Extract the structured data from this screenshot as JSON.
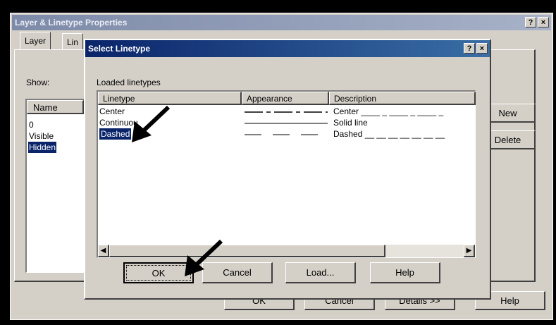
{
  "outer": {
    "title": "Layer & Linetype Properties",
    "help_btn": "?",
    "close_btn": "×",
    "tabs": [
      "Layer",
      "Lin"
    ],
    "show_label": "Show:",
    "list_header": "Name",
    "layers": [
      "0",
      "Visible",
      "Hidden"
    ],
    "new_btn": "New",
    "delete_btn": "Delete",
    "ok_btn": "OK",
    "cancel_btn": "Cancel",
    "details_btn": "Details >>",
    "help_footer_btn": "Help"
  },
  "dialog": {
    "title": "Select Linetype",
    "help_btn": "?",
    "close_btn": "×",
    "group_label": "Loaded linetypes",
    "columns": [
      "Linetype",
      "Appearance",
      "Description"
    ],
    "rows": [
      {
        "linetype": "Center",
        "description": "Center ____ _ ____ _ ____ _"
      },
      {
        "linetype": "Continuous",
        "description": "Solid line"
      },
      {
        "linetype": "Dashed",
        "description": "Dashed __ __ __ __ __ __ __"
      }
    ],
    "selected_row": "Dashed",
    "ok_btn": "OK",
    "cancel_btn": "Cancel",
    "load_btn": "Load...",
    "help_footer_btn": "Help"
  },
  "icons": {
    "scroll_left": "left-arrow-icon",
    "scroll_right": "right-arrow-icon",
    "pointer_1": "pointer-arrow-icon",
    "pointer_2": "pointer-arrow-icon"
  },
  "colors": {
    "active_title": "#0a246a",
    "inactive_title": "#7d8aa8",
    "selection": "#0a246a",
    "face": "#d4d0c8"
  }
}
